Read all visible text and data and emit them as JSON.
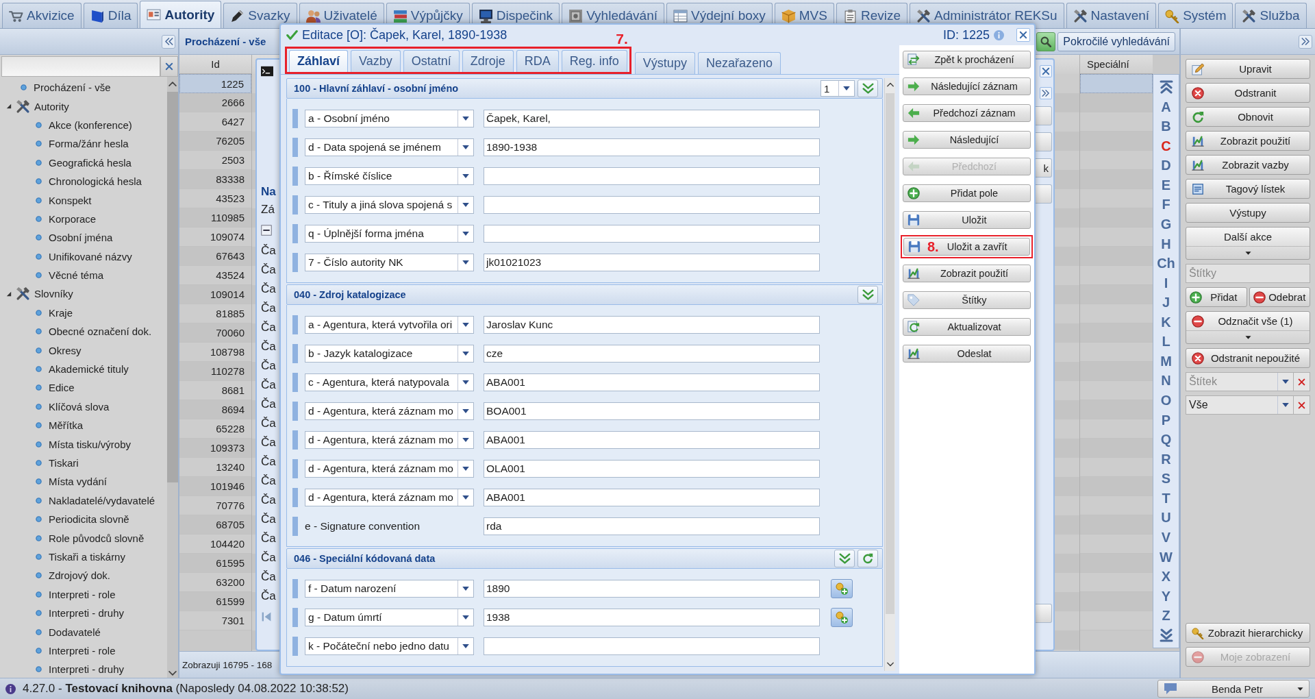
{
  "top_tabs": [
    {
      "label": "Akvizice",
      "selected": false
    },
    {
      "label": "Díla",
      "selected": false
    },
    {
      "label": "Autority",
      "selected": true
    },
    {
      "label": "Svazky",
      "selected": false
    },
    {
      "label": "Uživatelé",
      "selected": false
    },
    {
      "label": "Výpůjčky",
      "selected": false
    },
    {
      "label": "Dispečink",
      "selected": false
    },
    {
      "label": "Vyhledávání",
      "selected": false
    },
    {
      "label": "Výdejní boxy",
      "selected": false
    },
    {
      "label": "MVS",
      "selected": false
    },
    {
      "label": "Revize",
      "selected": false
    },
    {
      "label": "Administrátor REKSu",
      "selected": false
    },
    {
      "label": "Nastavení",
      "selected": false
    },
    {
      "label": "Systém",
      "selected": false
    },
    {
      "label": "Služba",
      "selected": false
    }
  ],
  "left_panel": {
    "tree": [
      {
        "label": "Procházení - vše"
      },
      {
        "label": "Autority",
        "expanded": true,
        "children": [
          {
            "label": "Akce (konference)"
          },
          {
            "label": "Forma/žánr hesla"
          },
          {
            "label": "Geografická hesla"
          },
          {
            "label": "Chronologická hesla"
          },
          {
            "label": "Konspekt"
          },
          {
            "label": "Korporace"
          },
          {
            "label": "Osobní jména"
          },
          {
            "label": "Unifikované názvy"
          },
          {
            "label": "Věcné téma"
          }
        ]
      },
      {
        "label": "Slovníky",
        "expanded": true,
        "children": [
          {
            "label": "Kraje"
          },
          {
            "label": "Obecné označení dok."
          },
          {
            "label": "Okresy"
          },
          {
            "label": "Akademické tituly"
          },
          {
            "label": "Edice"
          },
          {
            "label": "Klíčová slova"
          },
          {
            "label": "Měřítka"
          },
          {
            "label": "Místa tisku/výroby"
          },
          {
            "label": "Tiskari"
          },
          {
            "label": "Místa vydání"
          },
          {
            "label": "Nakladatelé/vydavatelé"
          },
          {
            "label": "Periodicita slovně"
          },
          {
            "label": "Role původců slovně"
          },
          {
            "label": "Tiskaři a tiskárny"
          },
          {
            "label": "Zdrojový dok."
          },
          {
            "label": "Interpreti - role"
          },
          {
            "label": "Interpreti - druhy"
          },
          {
            "label": "Dodavatelé"
          },
          {
            "label": "Interpreti - role"
          },
          {
            "label": "Interpreti - druhy"
          }
        ]
      }
    ]
  },
  "browse": {
    "title": "Procházení - vše",
    "advanced_search": "Pokročilé vyhledávání",
    "columns": [
      "Id",
      "Speciální"
    ],
    "rows": [
      {
        "id": "1225",
        "selected": true
      },
      {
        "id": "2666",
        "selected": false
      },
      {
        "id": "6427",
        "selected": false
      },
      {
        "id": "76205",
        "selected": false
      },
      {
        "id": "2503",
        "selected": false
      },
      {
        "id": "83338",
        "selected": false
      },
      {
        "id": "43523",
        "selected": false
      },
      {
        "id": "110985",
        "selected": false
      },
      {
        "id": "109074",
        "selected": false
      },
      {
        "id": "67643",
        "selected": false
      },
      {
        "id": "43524",
        "selected": false
      },
      {
        "id": "109014",
        "selected": false
      },
      {
        "id": "81885",
        "selected": false
      },
      {
        "id": "70060",
        "selected": false
      },
      {
        "id": "108798",
        "selected": false
      },
      {
        "id": "110278",
        "selected": false
      },
      {
        "id": "8681",
        "selected": false
      },
      {
        "id": "8694",
        "selected": false
      },
      {
        "id": "65228",
        "selected": false
      },
      {
        "id": "109373",
        "selected": false
      },
      {
        "id": "13240",
        "selected": false
      },
      {
        "id": "101946",
        "selected": false
      },
      {
        "id": "70776",
        "selected": false
      },
      {
        "id": "68705",
        "selected": false
      },
      {
        "id": "104420",
        "selected": false
      },
      {
        "id": "61595",
        "selected": false
      },
      {
        "id": "63200",
        "selected": false
      },
      {
        "id": "61599",
        "selected": false
      },
      {
        "id": "7301",
        "selected": false
      }
    ],
    "footer": "Zobrazuji 16795 - 168"
  },
  "detail_panel": {
    "heading": "Na",
    "tab": "Zá",
    "rows": [
      "Ča",
      "Ča",
      "Ča",
      "Ča",
      "Ča",
      "Ča",
      "Ča",
      "Ča",
      "Ča",
      "Ča",
      "Ča",
      "Ča",
      "Ča",
      "Ča",
      "Ča",
      "Ča",
      "Ča",
      "Ča",
      "Ča"
    ],
    "button_fragment": "k"
  },
  "alphabet": [
    {
      "letter": "A",
      "selected": false
    },
    {
      "letter": "B",
      "selected": false
    },
    {
      "letter": "C",
      "selected": true
    },
    {
      "letter": "D",
      "selected": false
    },
    {
      "letter": "E",
      "selected": false
    },
    {
      "letter": "F",
      "selected": false
    },
    {
      "letter": "G",
      "selected": false
    },
    {
      "letter": "H",
      "selected": false
    },
    {
      "letter": "Ch",
      "selected": false
    },
    {
      "letter": "I",
      "selected": false
    },
    {
      "letter": "J",
      "selected": false
    },
    {
      "letter": "K",
      "selected": false
    },
    {
      "letter": "L",
      "selected": false
    },
    {
      "letter": "M",
      "selected": false
    },
    {
      "letter": "N",
      "selected": false
    },
    {
      "letter": "O",
      "selected": false
    },
    {
      "letter": "P",
      "selected": false
    },
    {
      "letter": "Q",
      "selected": false
    },
    {
      "letter": "R",
      "selected": false
    },
    {
      "letter": "S",
      "selected": false
    },
    {
      "letter": "T",
      "selected": false
    },
    {
      "letter": "U",
      "selected": false
    },
    {
      "letter": "V",
      "selected": false
    },
    {
      "letter": "W",
      "selected": false
    },
    {
      "letter": "X",
      "selected": false
    },
    {
      "letter": "Y",
      "selected": false
    },
    {
      "letter": "Z",
      "selected": false
    }
  ],
  "tools": {
    "items": [
      {
        "kind": "button",
        "label": "Upravit",
        "disabled": false
      },
      {
        "kind": "button",
        "label": "Odstranit",
        "disabled": false
      },
      {
        "kind": "button",
        "label": "Obnovit",
        "disabled": false
      },
      {
        "kind": "button",
        "label": "Zobrazit použití",
        "disabled": false
      },
      {
        "kind": "button",
        "label": "Zobrazit vazby",
        "disabled": false
      },
      {
        "kind": "button",
        "label": "Tagový lístek",
        "disabled": false
      },
      {
        "kind": "button",
        "label": "Výstupy",
        "disabled": false
      },
      {
        "kind": "menu",
        "label": "Další akce",
        "disabled": false
      },
      {
        "kind": "field",
        "placeholder": "Štítky"
      },
      {
        "kind": "pair",
        "buttons": [
          {
            "label": "Přidat",
            "disabled": false
          },
          {
            "label": "Odebrat",
            "disabled": false
          }
        ]
      },
      {
        "kind": "menu",
        "label": "Odznačit vše (1)",
        "disabled": false
      },
      {
        "kind": "button",
        "label": "Odstranit nepoužité",
        "disabled": false
      },
      {
        "kind": "combo",
        "placeholder": "Štítek"
      },
      {
        "kind": "combo",
        "value": "Vše"
      }
    ],
    "bottom": [
      {
        "label": "Zobrazit hierarchicky",
        "disabled": false
      },
      {
        "label": "Moje zobrazení",
        "disabled": true
      }
    ]
  },
  "editor": {
    "title": "Editace [O]: Čapek, Karel, 1890-1938",
    "record_id": "ID: 1225",
    "tabs_callout": "7.",
    "tabs": [
      {
        "label": "Záhlaví",
        "selected": true,
        "in_callout": true
      },
      {
        "label": "Vazby",
        "selected": false,
        "in_callout": true
      },
      {
        "label": "Ostatní",
        "selected": false,
        "in_callout": true
      },
      {
        "label": "Zdroje",
        "selected": false,
        "in_callout": true
      },
      {
        "label": "RDA",
        "selected": false,
        "in_callout": true
      },
      {
        "label": "Reg. info",
        "selected": false,
        "in_callout": true
      },
      {
        "label": "Výstupy",
        "selected": false,
        "in_callout": false
      },
      {
        "label": "Nezařazeno",
        "selected": false,
        "in_callout": false
      }
    ],
    "sections": [
      {
        "heading": "100 - Hlavní záhlaví - osobní jméno",
        "occurrence": "1",
        "refresh": false,
        "fields": [
          {
            "kind": "select",
            "subfield": "a - Osobní jméno",
            "value": "Čapek, Karel,",
            "lookup": false
          },
          {
            "kind": "select",
            "subfield": "d - Data spojená se jménem",
            "value": "1890-1938",
            "lookup": false
          },
          {
            "kind": "select",
            "subfield": "b - Římské číslice",
            "lookup": false
          },
          {
            "kind": "select",
            "subfield": "c - Tituly a jiná slova spojená s",
            "lookup": false
          },
          {
            "kind": "select",
            "subfield": "q - Úplnější forma jména",
            "lookup": false
          },
          {
            "kind": "select",
            "subfield": "7 - Číslo autority NK",
            "value": "jk01021023",
            "lookup": false
          }
        ]
      },
      {
        "heading": "040 - Zdroj katalogizace",
        "refresh": false,
        "fields": [
          {
            "kind": "select",
            "subfield": "a - Agentura, která vytvořila ori",
            "value": "Jaroslav Kunc",
            "lookup": false
          },
          {
            "kind": "select",
            "subfield": "b - Jazyk katalogizace",
            "value": "cze",
            "lookup": false
          },
          {
            "kind": "select",
            "subfield": "c - Agentura, která natypovala",
            "value": "ABA001",
            "lookup": false
          },
          {
            "kind": "select",
            "subfield": "d - Agentura, která záznam mo",
            "value": "BOA001",
            "lookup": false
          },
          {
            "kind": "select",
            "subfield": "d - Agentura, která záznam mo",
            "value": "ABA001",
            "lookup": false
          },
          {
            "kind": "select",
            "subfield": "d - Agentura, která záznam mo",
            "value": "OLA001",
            "lookup": false
          },
          {
            "kind": "select",
            "subfield": "d - Agentura, která záznam mo",
            "value": "ABA001",
            "lookup": false
          },
          {
            "kind": "label",
            "subfield": "e - Signature convention",
            "value": "rda",
            "lookup": false
          }
        ]
      },
      {
        "heading": "046 - Speciální kódovaná data",
        "refresh": true,
        "fields": [
          {
            "kind": "select",
            "subfield": "f - Datum narození",
            "value": "1890",
            "lookup": true
          },
          {
            "kind": "select",
            "subfield": "g - Datum úmrtí",
            "value": "1938",
            "lookup": true
          },
          {
            "kind": "select",
            "subfield": "k - Počáteční nebo jedno datu",
            "lookup": false
          }
        ]
      }
    ],
    "actions": [
      {
        "label": "Zpět k procházení",
        "disabled": false
      },
      {
        "label": "Následující záznam",
        "disabled": false
      },
      {
        "label": "Předchozí záznam",
        "disabled": false
      },
      {
        "label": "Následující",
        "disabled": false
      },
      {
        "label": "Předchozí",
        "disabled": true
      },
      {
        "label": "Přidat pole",
        "disabled": false
      },
      {
        "label": "Uložit",
        "disabled": false
      },
      {
        "label": "Uložit a zavřít",
        "disabled": false,
        "callout": "8."
      },
      {
        "label": "Zobrazit použití",
        "disabled": false
      },
      {
        "label": "Štítky",
        "disabled": false
      },
      {
        "label": "Aktualizovat",
        "disabled": false
      },
      {
        "label": "Odeslat",
        "disabled": false
      }
    ]
  },
  "status_bar": {
    "text": "4.27.0 - **Testovací knihovna** (Naposledy 04.08.2022 10:38:52)",
    "user": "Benda Petr"
  }
}
